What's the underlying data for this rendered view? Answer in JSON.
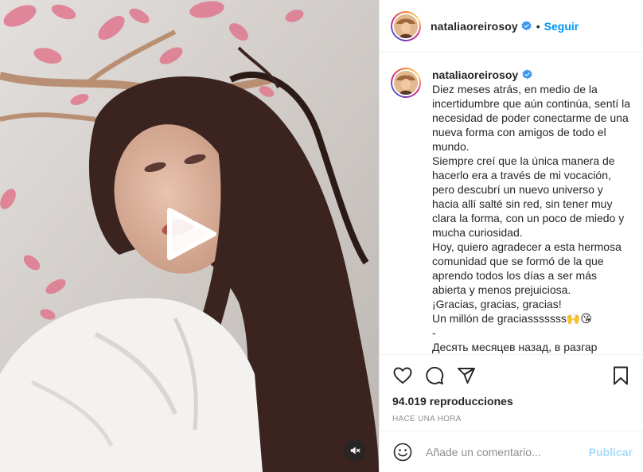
{
  "post": {
    "username": "nataliaoreirosoy",
    "follow_label": "Seguir",
    "separator": "•",
    "caption_lines": [
      "Diez meses atrás, en medio de la incertidumbre que aún continúa, sentí la necesidad de poder conectarme de una nueva forma con amigos de todo el mundo.",
      "Siempre creí que la única manera de hacerlo era a través de mi vocación, pero descubrí un nuevo universo y hacia allí salté sin red, sin tener muy clara la forma, con un poco de miedo y mucha curiosidad.",
      "Hoy, quiero agradecer a esta hermosa comunidad que se formó de la que aprendo todos los días a ser más abierta y menos prejuiciosa.",
      "¡Gracias, gracias, gracias!",
      "Un millón de graciasssssss🙌😘",
      "-",
      "Десять месяцев назад, в разгар"
    ],
    "views": "94.019 reproducciones",
    "time_ago": "HACE UNA HORA",
    "comment_placeholder": "Añade un comentario...",
    "publish_label": "Publicar"
  },
  "icons": {
    "play": "play-icon",
    "audio": "audio-muted-icon",
    "like": "heart-icon",
    "comment": "comment-icon",
    "share": "paper-plane-icon",
    "save": "bookmark-icon",
    "emoji": "emoji-icon",
    "verified": "verified-badge-icon"
  },
  "colors": {
    "accent": "#0095f6",
    "text": "#262626",
    "muted": "#8e8e8e",
    "border": "#efefef"
  }
}
